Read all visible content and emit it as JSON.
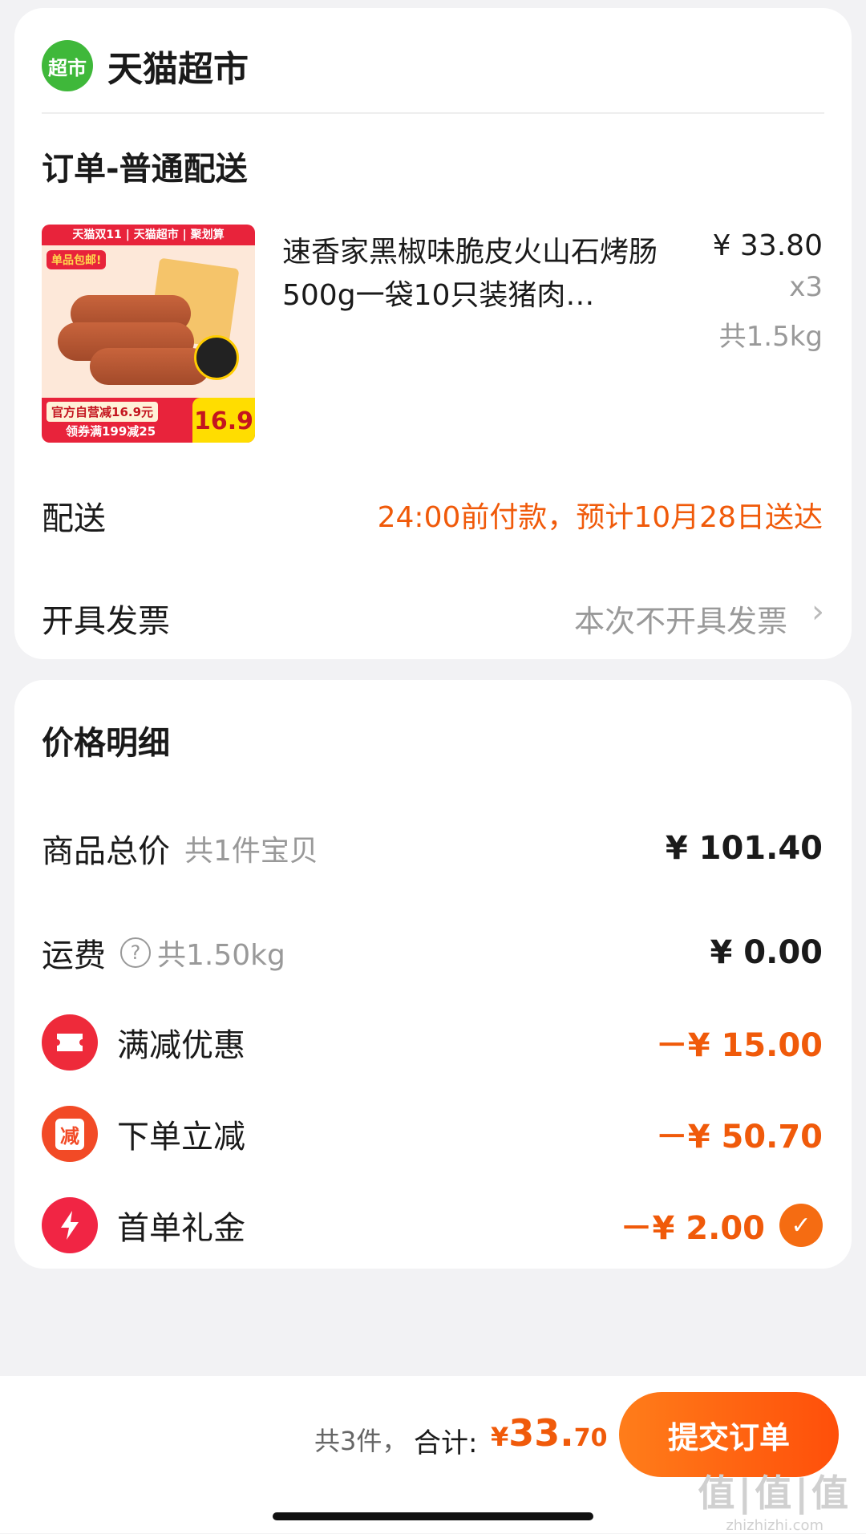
{
  "store": {
    "logo_text": "超市",
    "name": "天猫超市"
  },
  "order": {
    "section_title": "订单-普通配送",
    "product": {
      "thumb_banner": "天猫双11 | 天猫超市 | 聚划算",
      "thumb_free": "单品包邮!",
      "thumb_promo1": "官方自营减16.9元",
      "thumb_promo2": "领券满199减25",
      "thumb_price": "16.9",
      "title": "速香家黑椒味脆皮火山石烤肠500g一袋10只装猪肉…",
      "price": "¥ 33.80",
      "qty": "x3",
      "weight": "共1.5kg"
    },
    "delivery_label": "配送",
    "delivery_value": "24:00前付款，预计10月28日送达",
    "invoice_label": "开具发票",
    "invoice_value": "本次不开具发票"
  },
  "price_detail": {
    "title": "价格明细",
    "goods_total_label": "商品总价",
    "goods_total_sub": "共1件宝贝",
    "goods_total_value": "¥ 101.40",
    "shipping_label": "运费",
    "shipping_sub": "共1.50kg",
    "shipping_value": "¥ 0.00",
    "discounts": [
      {
        "icon": "coupon-icon",
        "label": "满减优惠",
        "value": "－¥ 15.00"
      },
      {
        "icon": "reduce-icon",
        "icon_text": "减",
        "label": "下单立减",
        "value": "－¥ 50.70"
      },
      {
        "icon": "lightning-icon",
        "label": "首单礼金",
        "value": "－¥ 2.00"
      }
    ]
  },
  "footer": {
    "count": "共3件，",
    "sum_label": "合计:",
    "yen": "¥",
    "amount_int": "33.",
    "amount_dec": "70",
    "submit_label": "提交订单",
    "watermark_main": "值|值|值",
    "watermark_sub": "zhizhizhi.com"
  },
  "colors": {
    "accent": "#f05a0a",
    "tmall_green": "#3fb83a",
    "discount_red": "#ee2a3a"
  }
}
